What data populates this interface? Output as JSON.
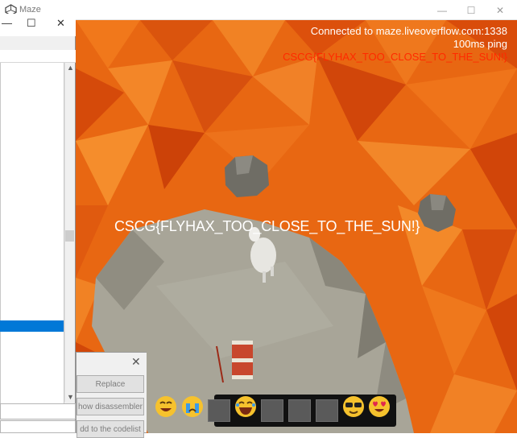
{
  "window": {
    "title": "Maze",
    "minimize_glyph": "—",
    "maximize_glyph": "☐",
    "close_glyph": "✕"
  },
  "game": {
    "status": {
      "connected": "Connected to maze.liveoverflow.com:1338",
      "ping": "100ms ping",
      "flag_top": "CSCG{FLYHAX_TOO_CLOSE_TO_THE_SUN!}"
    },
    "flag_center": "CSCG{FLYHAX_TOO_CLOSE_TO_THE_SUN!}",
    "colors": {
      "lava": "#e86712",
      "lava_dark": "#c9410a",
      "ground": "#a9a69a",
      "flag_top": "#ff2a00",
      "status_text": "#ffffff"
    },
    "hotbar": {
      "slots": [
        {
          "kind": "emoji",
          "icon": "grin-emoji-icon"
        },
        {
          "kind": "emoji",
          "icon": "crying-emoji-icon"
        },
        {
          "kind": "empty"
        },
        {
          "kind": "emoji",
          "icon": "laughing-emoji-icon"
        },
        {
          "kind": "empty"
        },
        {
          "kind": "empty"
        },
        {
          "kind": "empty"
        },
        {
          "kind": "emoji",
          "icon": "sunglasses-emoji-icon"
        },
        {
          "kind": "emoji",
          "icon": "heart-eyes-emoji-icon"
        }
      ]
    }
  },
  "left_window": {
    "minimize_glyph": "—",
    "maximize_glyph": "☐",
    "close_glyph": "✕",
    "scroll_up": "▲",
    "scroll_down": "▼"
  },
  "dialog": {
    "close_glyph": "✕",
    "buttons": {
      "replace": "Replace",
      "show_disassembler": "how disassembler",
      "add_codelist": "dd to the codelist"
    }
  }
}
